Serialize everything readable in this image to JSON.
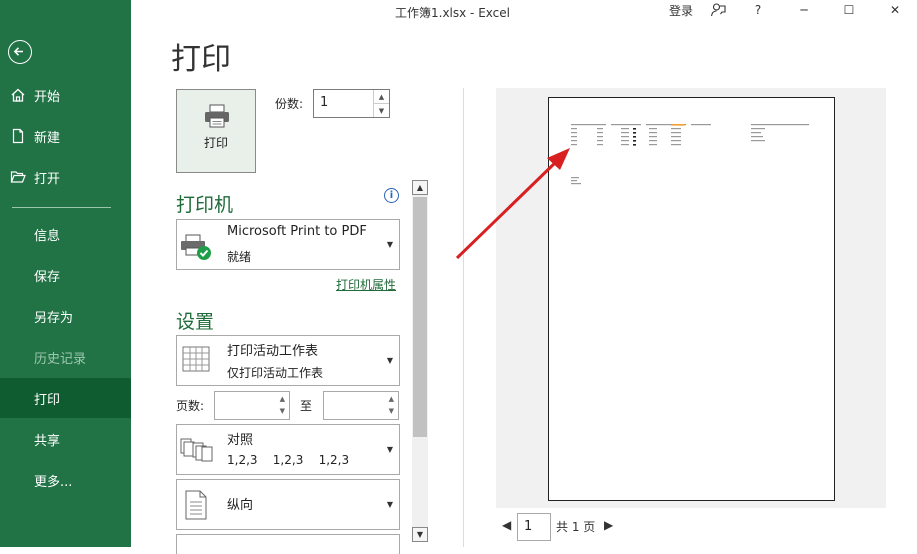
{
  "window": {
    "title": "工作簿1.xlsx  -  Excel",
    "login": "登录",
    "minimize_glyph": "─",
    "maximize_glyph": "☐",
    "close_glyph": "✕"
  },
  "sidebar": {
    "back": "back-arrow-icon",
    "items": [
      {
        "label": "开始",
        "icon": "home-icon"
      },
      {
        "label": "新建",
        "icon": "new-file-icon"
      },
      {
        "label": "打开",
        "icon": "open-folder-icon"
      },
      {
        "label": "信息"
      },
      {
        "label": "保存"
      },
      {
        "label": "另存为"
      },
      {
        "label": "历史记录",
        "disabled": true
      },
      {
        "label": "打印",
        "active": true
      },
      {
        "label": "共享"
      },
      {
        "label": "更多..."
      }
    ]
  },
  "main": {
    "heading": "打印",
    "print_button": "打印",
    "copies": {
      "label": "份数:",
      "value": "1"
    },
    "printer_section": "打印机",
    "printer": {
      "name": "Microsoft Print to PDF",
      "status": "就绪"
    },
    "printer_properties": "打印机属性",
    "settings_section": "设置",
    "print_what": {
      "line1": "打印活动工作表",
      "line2": "仅打印活动工作表"
    },
    "pages": {
      "label": "页数:",
      "to": "至",
      "from_value": "",
      "to_value": ""
    },
    "collate": {
      "line1": "对照",
      "line2": "1,2,3    1,2,3    1,2,3"
    },
    "orientation": {
      "line1": "纵向"
    }
  },
  "preview": {
    "current_page": "1",
    "total_label": "共 1 页"
  },
  "colors": {
    "sidebar_bg": "#217346",
    "sidebar_active": "#0e5c30",
    "accent_green": "#1f6b3a",
    "annotation_arrow": "#d92020"
  }
}
